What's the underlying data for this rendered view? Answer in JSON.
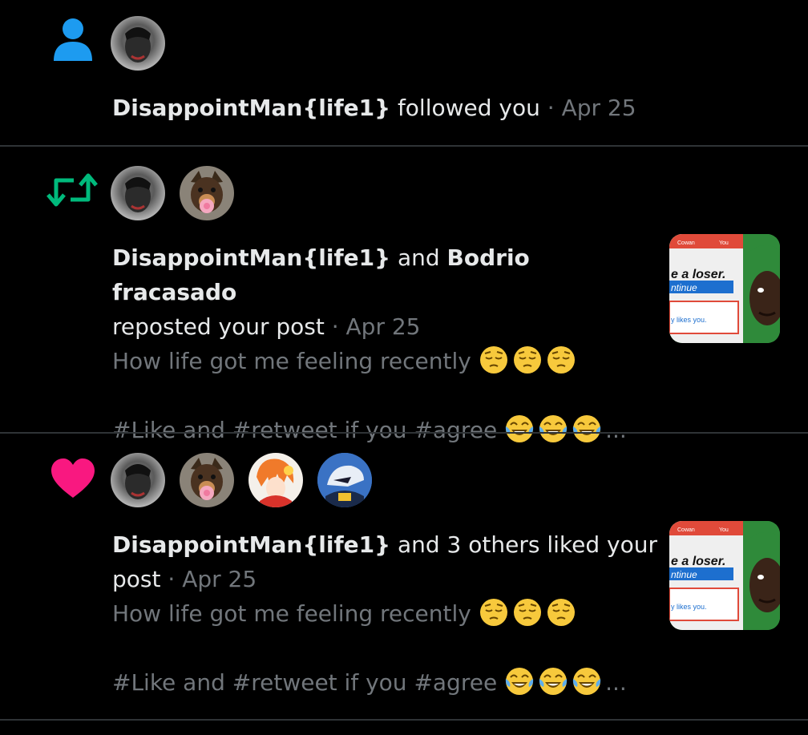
{
  "notifications": [
    {
      "type": "follow",
      "icon": "person-icon",
      "actor": "DisappointMan{life1}",
      "action_text": " followed you",
      "separator": " · ",
      "date": "Apr 25"
    },
    {
      "type": "repost",
      "icon": "repost-icon",
      "actor": "DisappointMan{life1}",
      "connector": " and ",
      "actor2": "Bodrio fracasado",
      "action_text": "reposted your post",
      "separator": " · ",
      "date": "Apr 25",
      "post_line1": "How life got me feeling recently ",
      "post_line2": "#Like and #retweet if you #agree ",
      "ellipsis": "...",
      "thumb_text": {
        "cowan": "Cowan",
        "you": "You",
        "loser": "e a loser.",
        "continue": "ntinue",
        "likes": "y likes you."
      }
    },
    {
      "type": "like",
      "icon": "heart-icon",
      "actor": "DisappointMan{life1}",
      "action_text": " and 3 others liked your post",
      "separator": " · ",
      "date": "Apr 25",
      "post_line1": "How life got me feeling recently ",
      "post_line2": "#Like and #retweet if you #agree ",
      "ellipsis": "...",
      "thumb_text": {
        "cowan": "Cowan",
        "you": "You",
        "loser": "e a loser.",
        "continue": "ntinue",
        "likes": "y likes you."
      }
    }
  ],
  "colors": {
    "follow_icon": "#1d9bf0",
    "repost_icon": "#00ba7c",
    "like_icon": "#f91880",
    "muted_text": "#71767b",
    "divider": "#2f3336"
  }
}
